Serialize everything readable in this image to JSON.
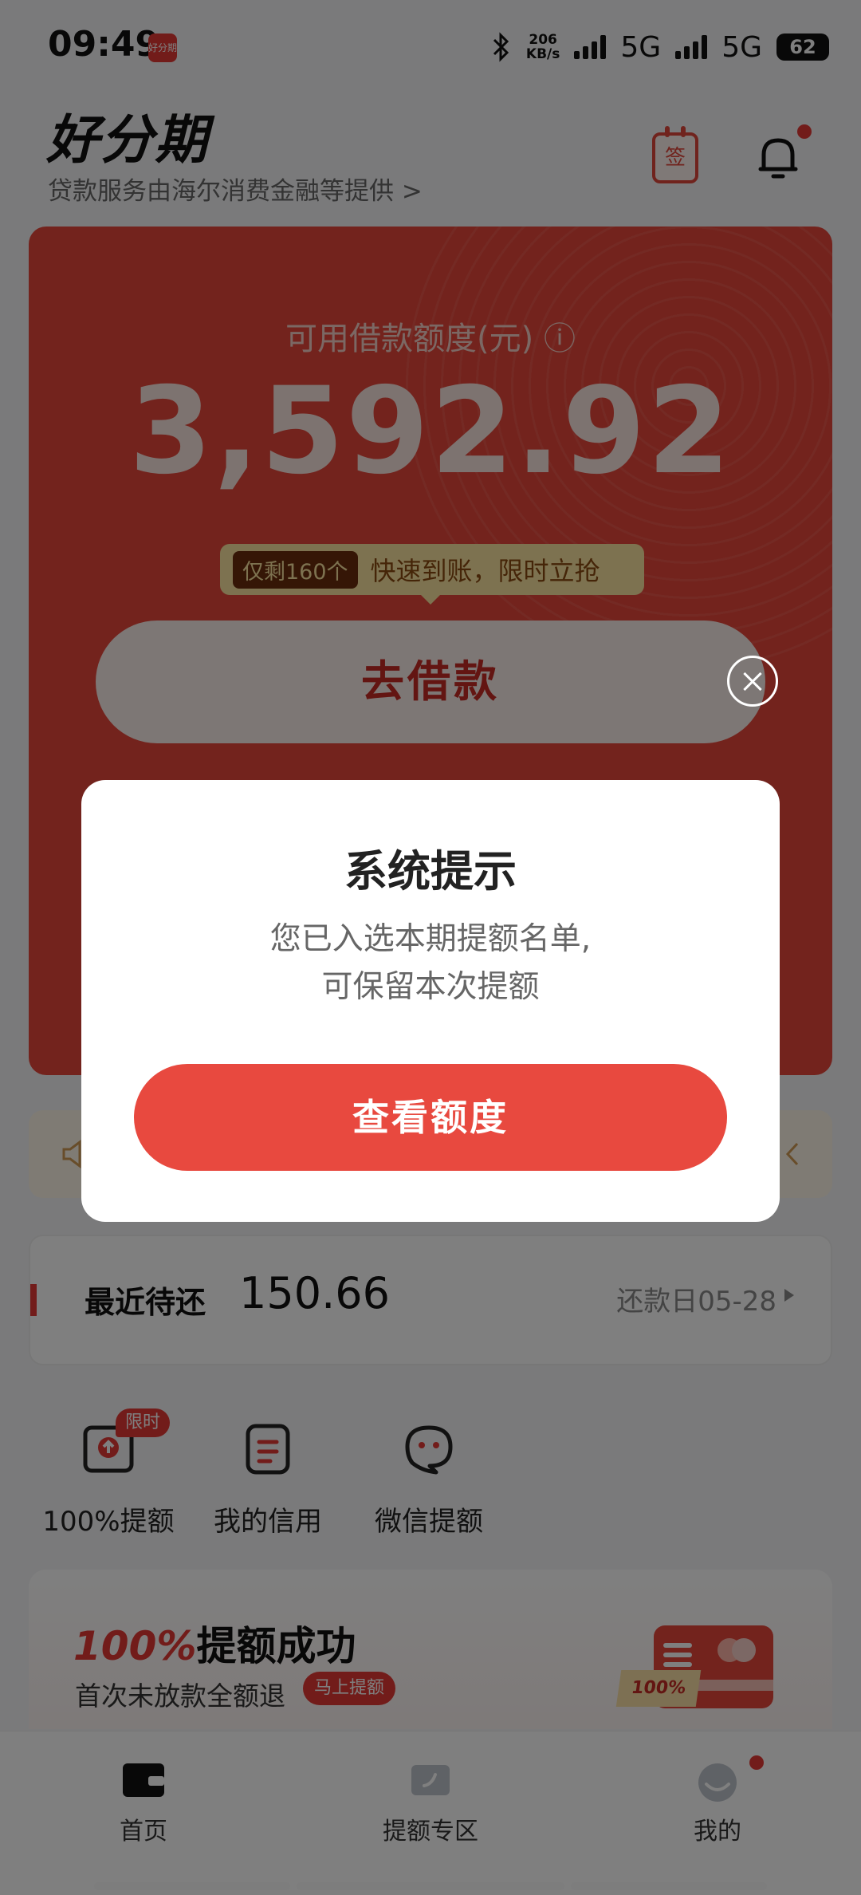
{
  "status_bar": {
    "time": "09:49",
    "app_badge": "好分期",
    "net_speed_value": "206",
    "net_speed_unit": "KB/s",
    "network1": "5G",
    "network2": "5G",
    "battery": "62"
  },
  "header": {
    "logo_text": "好分期",
    "subtitle": "贷款服务由海尔消费金融等提供 >",
    "sign_icon_label": "签"
  },
  "loan_card": {
    "label": "可用借款额度(元) ⓘ",
    "amount": "3,592.92",
    "promo_tag": "仅剩160个",
    "promo_text": "快速到账，限时立抢",
    "borrow_button": "去借款"
  },
  "recent_repayment": {
    "label": "最近待还",
    "amount": "150.66",
    "due": "还款日05-28"
  },
  "quick_actions": [
    {
      "label": "100%提额",
      "badge": "限时"
    },
    {
      "label": "我的信用"
    },
    {
      "label": "微信提额"
    }
  ],
  "promo_card": {
    "title_highlight": "100%",
    "title_rest": "提额成功",
    "subtitle": "首次未放款全额退",
    "pill": "马上提额",
    "ribbon": "100%"
  },
  "tabbar": {
    "tabs": [
      {
        "label": "首页"
      },
      {
        "label": "提额专区"
      },
      {
        "label": "我的"
      }
    ]
  },
  "dialog": {
    "title": "系统提示",
    "line1": "您已入选本期提额名单,",
    "line2": "可保留本次提额",
    "button": "查看额度"
  },
  "colors": {
    "brand_red": "#e7473b",
    "button_red": "#e8493f",
    "overlay": "rgba(0,0,0,0.5)"
  }
}
